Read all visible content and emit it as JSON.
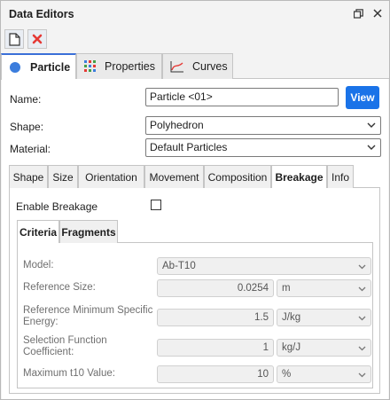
{
  "window": {
    "title": "Data Editors"
  },
  "main_tabs": [
    {
      "label": "Particle",
      "icon": "circle-icon"
    },
    {
      "label": "Properties",
      "icon": "grid-icon"
    },
    {
      "label": "Curves",
      "icon": "chart-icon"
    }
  ],
  "form": {
    "name_label": "Name:",
    "name_value": "Particle <01>",
    "view_button": "View",
    "shape_label": "Shape:",
    "shape_value": "Polyhedron",
    "material_label": "Material:",
    "material_value": "Default Particles"
  },
  "sub_tabs": [
    "Shape",
    "Size",
    "Orientation",
    "Movement",
    "Composition",
    "Breakage",
    "Info"
  ],
  "breakage": {
    "enable_label": "Enable Breakage",
    "enabled": false,
    "inner_tabs": [
      "Criteria",
      "Fragments"
    ],
    "model": {
      "label": "Model:",
      "value": "Ab-T10"
    },
    "reference_size": {
      "label": "Reference Size:",
      "value": "0.0254",
      "unit": "m"
    },
    "ref_energy": {
      "label_line1": "Reference Minimum Specific",
      "label_line2": "Energy:",
      "value": "1.5",
      "unit": "J/kg"
    },
    "selection": {
      "label_line1": "Selection Function",
      "label_line2": "Coefficient:",
      "value": "1",
      "unit": "kg/J"
    },
    "max_t10": {
      "label": "Maximum t10 Value:",
      "value": "10",
      "unit": "%"
    }
  },
  "colors": {
    "accent": "#1a73e8",
    "close_red": "#e53935",
    "tab_accent": "#3a6fd8"
  }
}
